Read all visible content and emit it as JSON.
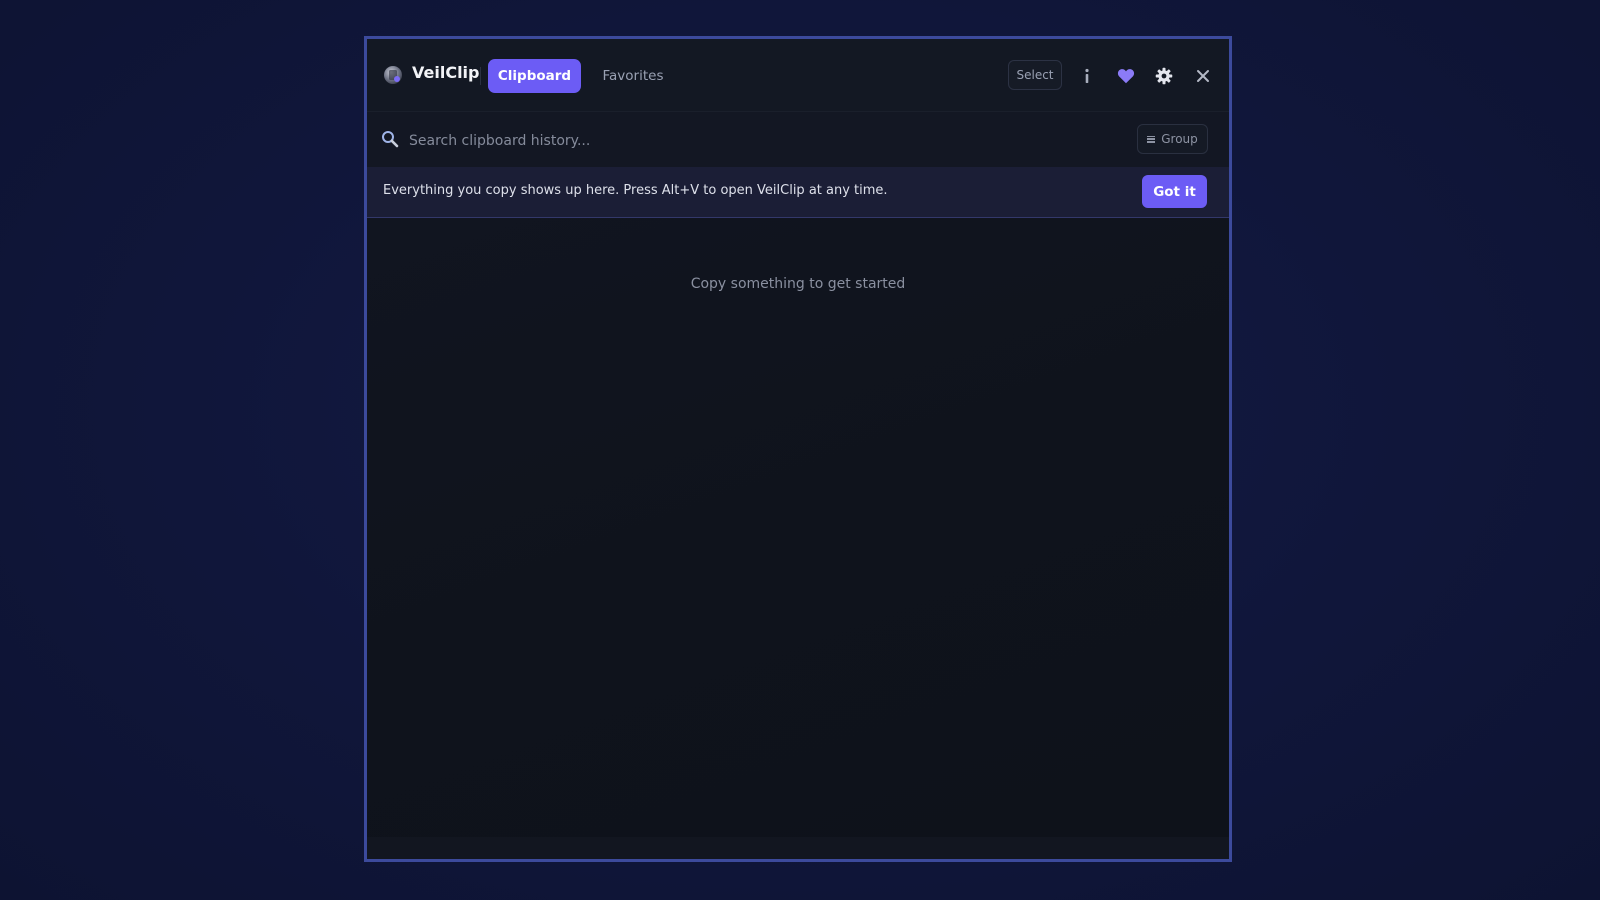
{
  "app": {
    "name": "VeilClip"
  },
  "tabs": [
    {
      "label": "Clipboard",
      "active": true
    },
    {
      "label": "Favorites",
      "active": false
    }
  ],
  "toolbar": {
    "select_label": "Select",
    "icons": [
      "info-icon",
      "heart-icon",
      "gear-icon",
      "close-icon"
    ]
  },
  "search": {
    "placeholder": "Search clipboard history...",
    "value": "",
    "group_label": "Group"
  },
  "banner": {
    "text": "Everything you copy shows up here. Press Alt+V to open VeilClip at any time.",
    "button_label": "Got it"
  },
  "empty_state": {
    "text": "Copy something to get started"
  },
  "colors": {
    "accent": "#6c5cf5",
    "window_border": "#3c4a9c",
    "background": "#101638",
    "panel": "#0f131c",
    "heart": "#8b7bf7"
  }
}
